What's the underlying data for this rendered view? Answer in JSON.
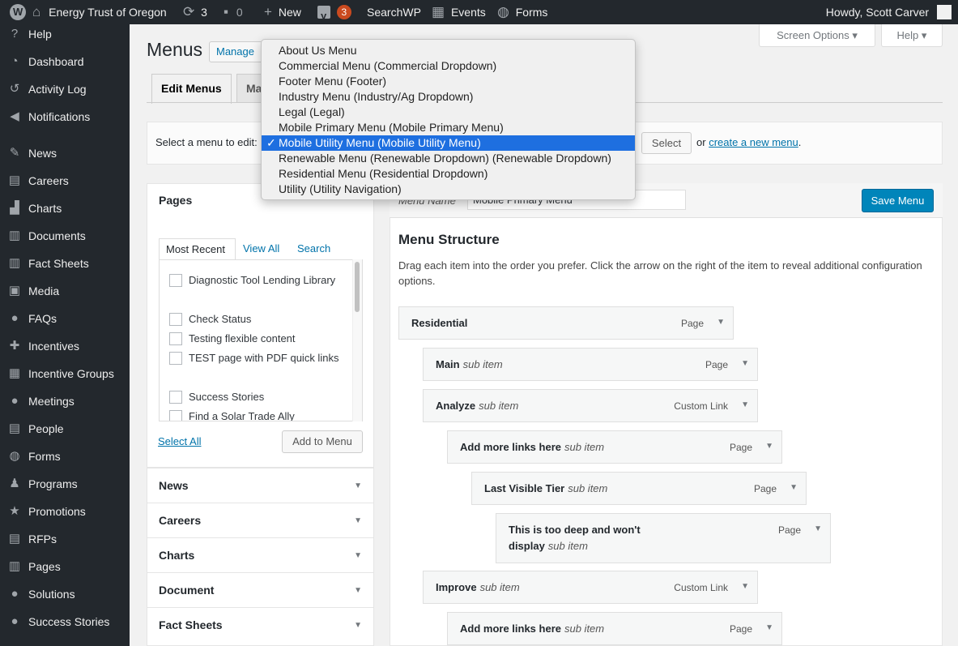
{
  "adminbar": {
    "site_name": "Energy Trust of Oregon",
    "updates_count": "3",
    "comments_count": "0",
    "new_label": "New",
    "yoast_badge": "3",
    "searchwp_label": "SearchWP",
    "events_label": "Events",
    "forms_label": "Forms",
    "howdy": "Howdy, Scott Carver"
  },
  "sidebar": {
    "items": [
      {
        "label": "Help",
        "icon": "help-icon"
      },
      {
        "label": "Dashboard",
        "icon": "dashboard-icon"
      },
      {
        "label": "Activity Log",
        "icon": "activity-log-icon"
      },
      {
        "label": "Notifications",
        "icon": "notifications-icon"
      },
      {
        "label": "News",
        "icon": "pin-icon"
      },
      {
        "label": "Careers",
        "icon": "careers-icon"
      },
      {
        "label": "Charts",
        "icon": "charts-icon"
      },
      {
        "label": "Documents",
        "icon": "documents-icon"
      },
      {
        "label": "Fact Sheets",
        "icon": "fact-sheets-icon"
      },
      {
        "label": "Media",
        "icon": "media-icon"
      },
      {
        "label": "FAQs",
        "icon": "faqs-icon"
      },
      {
        "label": "Incentives",
        "icon": "incentives-icon"
      },
      {
        "label": "Incentive Groups",
        "icon": "incentive-groups-icon"
      },
      {
        "label": "Meetings",
        "icon": "meetings-icon"
      },
      {
        "label": "People",
        "icon": "people-icon"
      },
      {
        "label": "Forms",
        "icon": "forms-icon"
      },
      {
        "label": "Programs",
        "icon": "programs-icon"
      },
      {
        "label": "Promotions",
        "icon": "promotions-icon"
      },
      {
        "label": "RFPs",
        "icon": "rfps-icon"
      },
      {
        "label": "Pages",
        "icon": "pages-icon"
      },
      {
        "label": "Solutions",
        "icon": "solutions-icon"
      },
      {
        "label": "Success Stories",
        "icon": "success-stories-icon"
      }
    ]
  },
  "top": {
    "screen_options": "Screen Options",
    "help": "Help"
  },
  "page": {
    "title": "Menus",
    "manage_btn": "Manage with Live Preview",
    "tabs": [
      "Edit Menus",
      "Manage Locations"
    ],
    "select_prompt": "Select a menu to edit:",
    "select_btn": "Select",
    "or_text": "or",
    "create_link": "create a new menu",
    "period": "."
  },
  "dropdown": {
    "options": [
      "About Us Menu",
      "Commercial Menu (Commercial Dropdown)",
      "Footer Menu (Footer)",
      "Industry Menu (Industry/Ag Dropdown)",
      "Legal (Legal)",
      "Mobile Primary Menu (Mobile Primary Menu)",
      "Mobile Utility Menu (Mobile Utility Menu)",
      "Renewable Menu (Renewable Dropdown) (Renewable Dropdown)",
      "Residential Menu (Residential Dropdown)",
      "Utility (Utility Navigation)"
    ],
    "selected_index": 6,
    "check": "✓"
  },
  "left": {
    "pages_title": "Pages",
    "tab_recent": "Most Recent",
    "tab_all": "View All",
    "tab_search": "Search",
    "pages": [
      "Diagnostic Tool Lending Library",
      "Check Status",
      "Testing flexible content",
      "TEST page with PDF quick links",
      "Success Stories",
      "Find a Solar Trade Ally"
    ],
    "select_all": "Select All",
    "add_to_menu": "Add to Menu",
    "sections": [
      "News",
      "Careers",
      "Charts",
      "Document",
      "Fact Sheets"
    ]
  },
  "right": {
    "menu_name_label": "Menu Name",
    "menu_name_value": "Mobile Primary Menu",
    "save_btn": "Save Menu",
    "structure_title": "Menu Structure",
    "structure_desc": "Drag each item into the order you prefer. Click the arrow on the right of the item to reveal additional configuration options.",
    "items": [
      {
        "title": "Residential",
        "sub": "",
        "type": "Page"
      },
      {
        "title": "Main",
        "sub": "sub item",
        "type": "Page"
      },
      {
        "title": "Analyze",
        "sub": "sub item",
        "type": "Custom Link"
      },
      {
        "title": "Add more links here",
        "sub": "sub item",
        "type": "Page"
      },
      {
        "title": "Last Visible Tier",
        "sub": "sub item",
        "type": "Page"
      },
      {
        "title": "This is too deep and won't display",
        "sub": "sub item",
        "type": "Page"
      },
      {
        "title": "Improve",
        "sub": "sub item",
        "type": "Custom Link"
      },
      {
        "title": "Add more links here",
        "sub": "sub item",
        "type": "Page"
      }
    ]
  },
  "colors": {
    "adminbar": "#23282d",
    "link": "#0073aa",
    "primary_button": "#0085ba",
    "dropdown_selected": "#1e6fe0",
    "badge": "#ca4a1f"
  }
}
